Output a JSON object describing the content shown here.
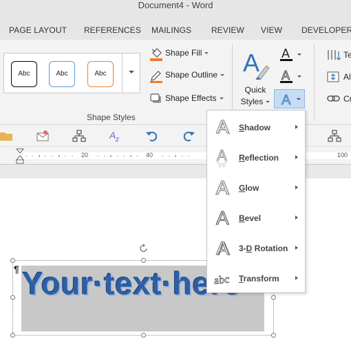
{
  "window": {
    "title": "Document4 - Word"
  },
  "tabs": [
    "PAGE LAYOUT",
    "REFERENCES",
    "MAILINGS",
    "REVIEW",
    "VIEW",
    "DEVELOPER"
  ],
  "ribbon": {
    "shape_styles": {
      "gallery": [
        "Abc",
        "Abc",
        "Abc"
      ],
      "shape_fill": "Shape Fill",
      "shape_outline": "Shape Outline",
      "shape_effects": "Shape Effects",
      "group_label": "Shape Styles"
    },
    "quick_styles": {
      "line1": "Quick",
      "line2": "Styles"
    },
    "text_group": {
      "item1": "Te",
      "item2": "Al",
      "item3": "Cr"
    }
  },
  "ruler": {
    "marks": [
      "20",
      "40",
      "100"
    ]
  },
  "document": {
    "pilcrow": "¶",
    "wordart_text": "Your·text·here"
  },
  "text_effects_menu": {
    "items": [
      {
        "pre": "",
        "key": "S",
        "post": "hadow"
      },
      {
        "pre": "",
        "key": "R",
        "post": "eflection"
      },
      {
        "pre": "",
        "key": "G",
        "post": "low"
      },
      {
        "pre": "",
        "key": "B",
        "post": "evel"
      },
      {
        "pre": "3-",
        "key": "D",
        "post": " Rotation"
      },
      {
        "pre": "",
        "key": "T",
        "post": "ransform"
      }
    ]
  },
  "colors": {
    "gallery_borders": [
      "#000000",
      "#5b9bd5",
      "#ed7d31"
    ],
    "wordart_fill": "#2e5fa3",
    "selected_button": "#c5dcf4",
    "shape_fill_swatch": "#ed7d31"
  },
  "icons": {
    "toolbar2": [
      "folder-icon",
      "envelope-icon",
      "org-chart-icon",
      "spelling-icon",
      "undo-icon",
      "redo-icon",
      "org-chart-icon"
    ]
  }
}
